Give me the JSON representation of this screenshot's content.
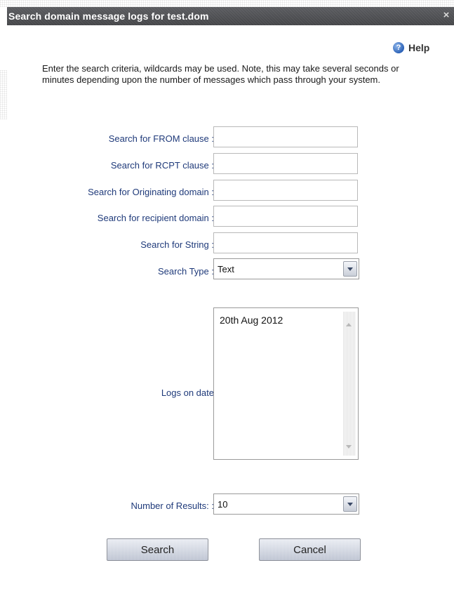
{
  "dialog": {
    "title": "Search domain message logs for test.dom",
    "close_glyph": "×",
    "help_label": "Help",
    "help_icon": "help-icon",
    "intro": "Enter the search criteria, wildcards may be used. Note, this may take several seconds or minutes depending upon the number of messages which pass through your system."
  },
  "form": {
    "from_label": "Search for FROM clause :",
    "from_value": "",
    "rcpt_label": "Search for RCPT clause :",
    "rcpt_value": "",
    "orig_domain_label": "Search for Originating domain :",
    "orig_domain_value": "",
    "recip_domain_label": "Search for recipient domain :",
    "recip_domain_value": "",
    "string_label": "Search for String :",
    "string_value": "",
    "search_type_label": "Search Type :",
    "search_type_value": "Text",
    "logs_date_label": "Logs on date",
    "logs_dates": [
      "20th Aug 2012"
    ],
    "num_results_label": "Number of Results: :",
    "num_results_value": "10"
  },
  "buttons": {
    "search": "Search",
    "cancel": "Cancel"
  },
  "colors": {
    "titlebar": "#4f5054",
    "label_text": "#1f3a7a",
    "button_top": "#e8ebf2",
    "button_bottom": "#b9c0cf"
  }
}
